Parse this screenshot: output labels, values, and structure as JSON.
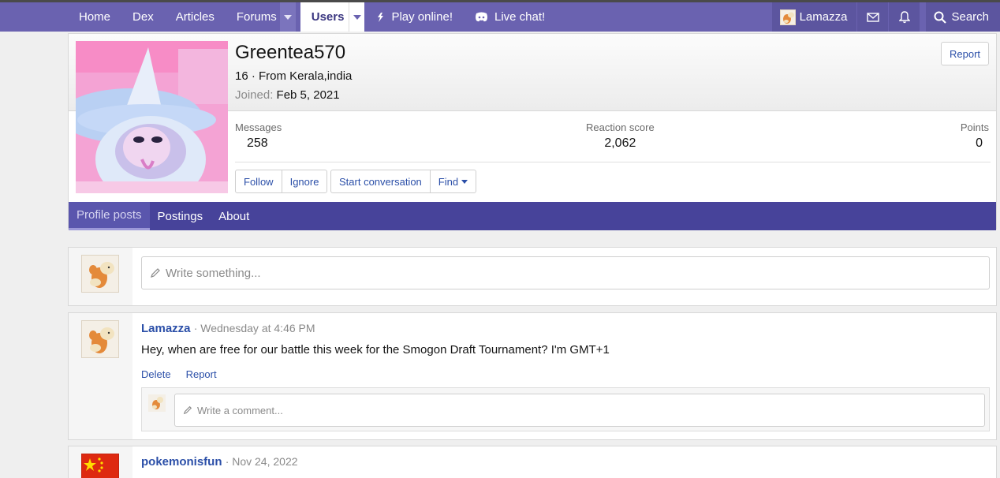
{
  "nav": {
    "items": [
      "Home",
      "Dex",
      "Articles",
      "Forums",
      "Users",
      "Play online!",
      "Live chat!"
    ],
    "user": "Lamazza",
    "search": "Search",
    "accent": "#6a62b0"
  },
  "profile": {
    "username": "Greentea570",
    "age_location": "16 · From Kerala,india",
    "joined_label": "Joined:",
    "joined_date": "Feb 5, 2021",
    "report": "Report",
    "stats": {
      "messages_label": "Messages",
      "messages": "258",
      "reaction_label": "Reaction score",
      "reaction": "2,062",
      "points_label": "Points",
      "points": "0"
    },
    "buttons": [
      "Follow",
      "Ignore",
      "Start conversation",
      "Find"
    ],
    "tabs": [
      "Profile posts",
      "Postings",
      "About"
    ],
    "tab_color": "#47439a"
  },
  "composer": {
    "placeholder": "Write something..."
  },
  "posts": [
    {
      "author": "Lamazza",
      "meta": "· Wednesday at 4:46 PM",
      "text": "Hey, when are free for our battle this week for the Smogon Draft Tournament? I'm GMT+1",
      "actions": [
        "Delete",
        "Report"
      ],
      "comment_placeholder": "Write a comment..."
    },
    {
      "author": "pokemonisfun",
      "meta": "· Nov 24, 2022"
    }
  ]
}
